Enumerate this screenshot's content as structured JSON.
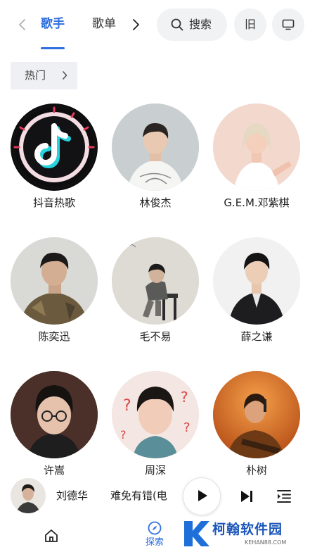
{
  "top_tabs": {
    "active": "歌手",
    "second": "歌单"
  },
  "search": {
    "label": "搜索"
  },
  "old_mode": {
    "label": "旧"
  },
  "filter": {
    "label": "热门"
  },
  "artists": [
    {
      "name": "抖音热歌"
    },
    {
      "name": "林俊杰"
    },
    {
      "name": "G.E.M.邓紫棋"
    },
    {
      "name": "陈奕迅"
    },
    {
      "name": "毛不易"
    },
    {
      "name": "薛之谦"
    },
    {
      "name": "许嵩"
    },
    {
      "name": "周深"
    },
    {
      "name": "朴树"
    }
  ],
  "player": {
    "artist": "刘德华",
    "song": "难免有错(电"
  },
  "bottom_nav": {
    "explore": "探索"
  },
  "watermark": {
    "text": "柯翰软件园",
    "sub": "KEHAN88.COM"
  },
  "colors": {
    "accent": "#2f6fdf",
    "chip_bg": "#eef0f3",
    "pill_bg": "#f1f2f4"
  }
}
